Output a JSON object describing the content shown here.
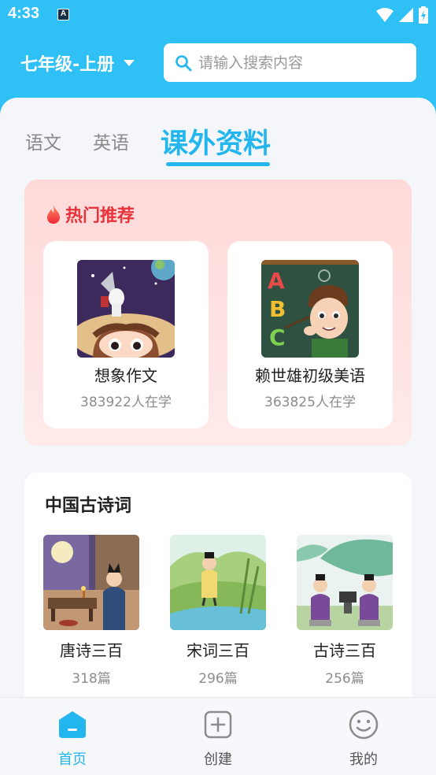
{
  "status_bar": {
    "time": "4:33",
    "app_badge": "A"
  },
  "header": {
    "grade": "七年级-上册",
    "search_placeholder": "请输入搜索内容"
  },
  "tabs": [
    {
      "label": "语文",
      "active": false
    },
    {
      "label": "英语",
      "active": false
    },
    {
      "label": "课外资料",
      "active": true
    }
  ],
  "hot": {
    "title": "热门推荐",
    "items": [
      {
        "name": "想象作文",
        "count": "383922人在学"
      },
      {
        "name": "赖世雄初级美语",
        "count": "363825人在学"
      }
    ]
  },
  "poetry": {
    "title": "中国古诗词",
    "items": [
      {
        "name": "唐诗三百",
        "count": "318篇"
      },
      {
        "name": "宋词三百",
        "count": "296篇"
      },
      {
        "name": "古诗三百",
        "count": "256篇"
      }
    ]
  },
  "bottom_nav": [
    {
      "label": "首页",
      "icon": "home-icon",
      "active": true
    },
    {
      "label": "创建",
      "icon": "plus-square-icon",
      "active": false
    },
    {
      "label": "我的",
      "icon": "smiley-icon",
      "active": false
    }
  ],
  "colors": {
    "accent": "#23b6ee",
    "header_bg": "#2fc0f5",
    "hot_title": "#e8333a",
    "hot_bg": "#ffdcdc"
  }
}
